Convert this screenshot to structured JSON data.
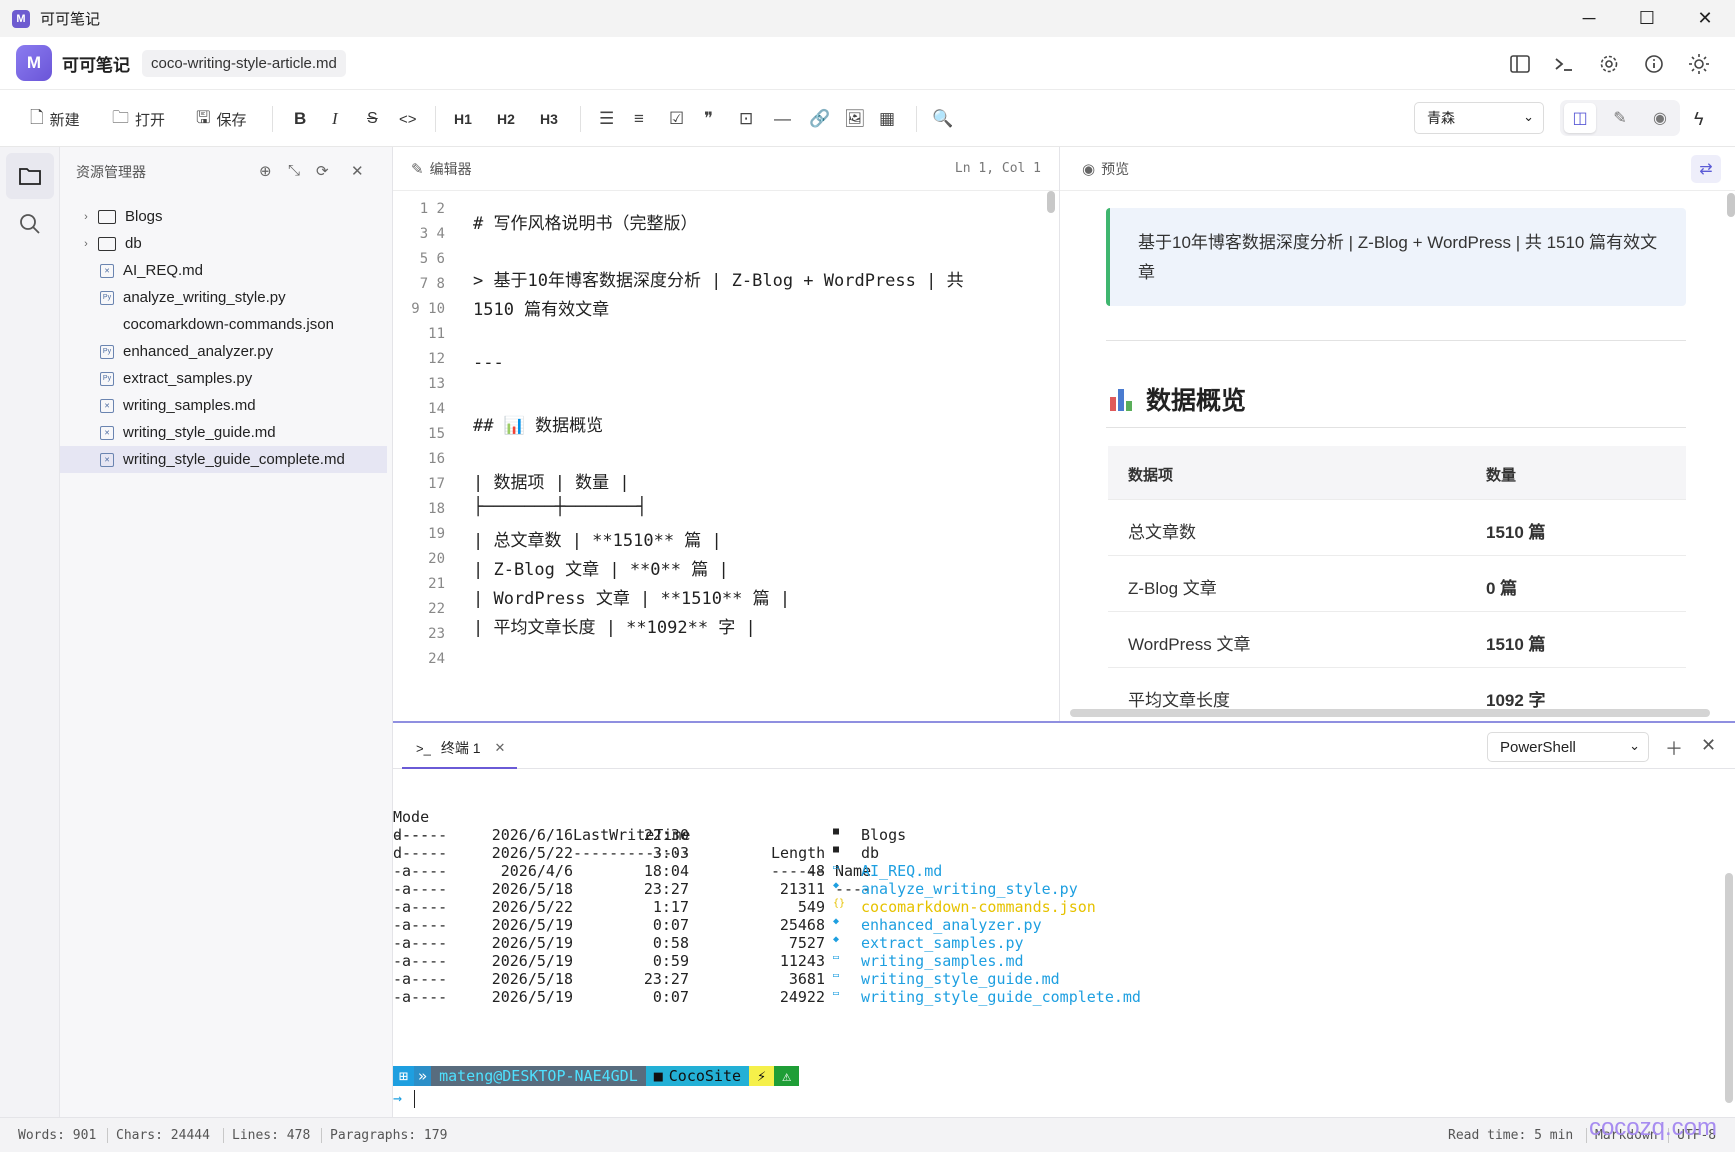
{
  "window": {
    "title": "可可笔记",
    "controls": {
      "minimize": "─",
      "maximize": "☐",
      "close": "✕"
    }
  },
  "header": {
    "app_name": "可可笔记",
    "file_name": "coco-writing-style-article.md",
    "logo_glyph": "M"
  },
  "toolbar": {
    "new_label": "新建",
    "open_label": "打开",
    "save_label": "保存",
    "bold": "B",
    "italic": "I",
    "strike": "S",
    "code": "<>",
    "h1": "H1",
    "h2": "H2",
    "h3": "H3",
    "theme_value": "青森"
  },
  "sidebar": {
    "title": "资源管理器",
    "items": [
      {
        "label": "Blogs",
        "type": "folder"
      },
      {
        "label": "db",
        "type": "folder"
      },
      {
        "label": "AI_REQ.md",
        "type": "md"
      },
      {
        "label": "analyze_writing_style.py",
        "type": "py"
      },
      {
        "label": "cocomarkdown-commands.json",
        "type": "json"
      },
      {
        "label": "enhanced_analyzer.py",
        "type": "py"
      },
      {
        "label": "extract_samples.py",
        "type": "py"
      },
      {
        "label": "writing_samples.md",
        "type": "md"
      },
      {
        "label": "writing_style_guide.md",
        "type": "md"
      },
      {
        "label": "writing_style_guide_complete.md",
        "type": "md",
        "selected": true
      }
    ]
  },
  "editor": {
    "title": "编辑器",
    "cursor": "Ln 1, Col 1",
    "line_numbers": [
      "1 2",
      "3 4",
      "5 6",
      "7 8",
      "9 10",
      "11",
      "12",
      "13",
      "14",
      "15",
      "16",
      "17",
      "18",
      "19",
      "20",
      "21",
      "22",
      "23",
      "24"
    ],
    "lines": [
      "# 写作风格说明书（完整版）",
      "> 基于10年博客数据深度分析 | Z-Blog + WordPress | 共",
      "1510 篇有效文章",
      "---",
      "## 📊 数据概览",
      "| 数据项 | 数量 |",
      "├───────┼───────┤",
      "| 总文章数 | **1510** 篇 |",
      "| Z-Blog 文章 | **0** 篇 |",
      "| WordPress 文章 | **1510** 篇 |",
      "| 平均文章长度 | **1092** 字 |"
    ]
  },
  "preview": {
    "title": "预览",
    "quote": "基于10年博客数据深度分析 | Z-Blog + WordPress | 共 1510 篇有效文章",
    "heading": "数据概览",
    "table": {
      "headers": [
        "数据项",
        "数量"
      ],
      "rows": [
        [
          "总文章数",
          "1510 篇"
        ],
        [
          "Z-Blog 文章",
          "0 篇"
        ],
        [
          "WordPress 文章",
          "1510 篇"
        ],
        [
          "平均文章长度",
          "1092 字"
        ]
      ]
    }
  },
  "terminal": {
    "tab_label": "终端 1",
    "shell": "PowerShell",
    "header": {
      "mode": "Mode",
      "time": "LastWriteTime",
      "length": "Length",
      "name": "Name"
    },
    "dashes": {
      "mode": "----",
      "time": "-------------",
      "length": "------",
      "name": "----"
    },
    "rows": [
      {
        "mode": "d-----",
        "date": "2026/6/16",
        "time": "22:30",
        "length": "",
        "icon": "■",
        "name": "Blogs",
        "color": "plain"
      },
      {
        "mode": "d-----",
        "date": "2026/5/22",
        "time": "3:03",
        "length": "",
        "icon": "■",
        "name": "db",
        "color": "plain"
      },
      {
        "mode": "-a----",
        "date": "2026/4/6",
        "time": "18:04",
        "length": "48",
        "icon": "▭",
        "name": "AI_REQ.md",
        "color": "blue"
      },
      {
        "mode": "-a----",
        "date": "2026/5/18",
        "time": "23:27",
        "length": "21311",
        "icon": "◆",
        "name": "analyze_writing_style.py",
        "color": "blue"
      },
      {
        "mode": "-a----",
        "date": "2026/5/22",
        "time": "1:17",
        "length": "549",
        "icon": "{}",
        "name": "cocomarkdown-commands.json",
        "color": "yellow"
      },
      {
        "mode": "-a----",
        "date": "2026/5/19",
        "time": "0:07",
        "length": "25468",
        "icon": "◆",
        "name": "enhanced_analyzer.py",
        "color": "blue"
      },
      {
        "mode": "-a----",
        "date": "2026/5/19",
        "time": "0:58",
        "length": "7527",
        "icon": "◆",
        "name": "extract_samples.py",
        "color": "blue"
      },
      {
        "mode": "-a----",
        "date": "2026/5/19",
        "time": "0:59",
        "length": "11243",
        "icon": "▭",
        "name": "writing_samples.md",
        "color": "blue"
      },
      {
        "mode": "-a----",
        "date": "2026/5/18",
        "time": "23:27",
        "length": "3681",
        "icon": "▭",
        "name": "writing_style_guide.md",
        "color": "blue"
      },
      {
        "mode": "-a----",
        "date": "2026/5/19",
        "time": "0:07",
        "length": "24922",
        "icon": "▭",
        "name": "writing_style_guide_complete.md",
        "color": "blue"
      }
    ],
    "prompt": {
      "user": "mateng@DESKTOP-NAE4GDL",
      "dir": "CocoSite",
      "bolt": "⚡",
      "warn": "⚠"
    },
    "cursor_arrow": "→"
  },
  "status": {
    "words": "Words: 901",
    "chars": "Chars: 24444",
    "lines": "Lines: 478",
    "paragraphs": "Paragraphs: 179",
    "read_time": "Read time: 5 min",
    "mode": "Markdown",
    "encoding": "UTF-8"
  },
  "watermark": "cocozq.com",
  "colors": {
    "accent": "#6a5ad6",
    "quote_border": "#3fb66f",
    "term_blue": "#1e9fe0",
    "term_yellow": "#e6c200"
  }
}
